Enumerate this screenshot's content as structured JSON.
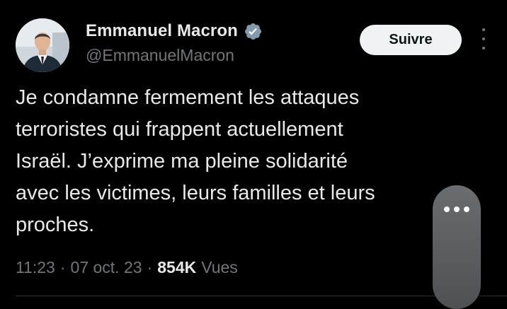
{
  "author": {
    "name": "Emmanuel Macron",
    "handle": "@EmmanuelMacron",
    "verified": true
  },
  "follow_button": {
    "label": "Suivre"
  },
  "tweet": {
    "lines": [
      "Je condamne fermement les attaques",
      "terroristes qui frappent actuellement",
      "Israël. J’exprime ma pleine solidarité",
      "avec les victimes, leurs familles et leurs",
      "proches."
    ]
  },
  "meta": {
    "time": "11:23",
    "separator": "·",
    "date": "07 oct. 23",
    "views_count": "854K",
    "views_label": "Vues"
  },
  "colors": {
    "background": "#000000",
    "text_primary": "#e7e9ea",
    "text_secondary": "#71767b",
    "verified_badge": "#829aab",
    "follow_button_bg": "#eff3f4",
    "divider": "#2f3336"
  },
  "icons": {
    "verified": "verified-badge-icon",
    "more": "more-vertical-icon",
    "overflow": "more-horizontal-icon"
  }
}
